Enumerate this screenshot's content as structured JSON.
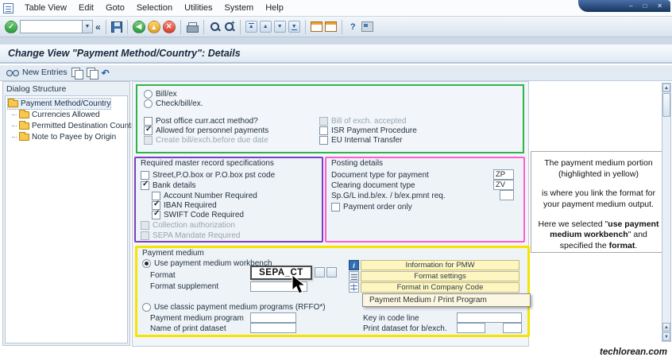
{
  "window": {
    "menu": [
      "Table View",
      "Edit",
      "Goto",
      "Selection",
      "Utilities",
      "System",
      "Help"
    ],
    "title": "Change View \"Payment Method/Country\": Details"
  },
  "icons": {
    "enter": "✓",
    "dropdown": "▼",
    "collapse": "«",
    "back": "◀",
    "exit": "▲",
    "cancel": "✕",
    "page_first": "▲",
    "page_prev": "▲",
    "page_next": "▼",
    "page_last": "▼",
    "help": "?",
    "undo": "↶",
    "minimize": "–",
    "restore": "□",
    "close": "✕",
    "info": "i",
    "scroll_up": "▲",
    "scroll_down": "▼"
  },
  "app_toolbar": {
    "new_entries": "New Entries"
  },
  "dialog_structure": {
    "title": "Dialog Structure",
    "items": [
      {
        "label": "Payment Method/Country",
        "selected": true
      },
      {
        "label": "Currencies Allowed",
        "selected": false
      },
      {
        "label": "Permitted Destination Countries",
        "selected": false
      },
      {
        "label": "Note to Payee by Origin",
        "selected": false
      }
    ]
  },
  "payment_method_section": {
    "radios": [
      {
        "label": "Bill/ex",
        "checked": false
      },
      {
        "label": "Check/bill/ex.",
        "checked": false
      }
    ],
    "left_checkboxes": [
      {
        "label": "Post office curr.acct method?",
        "checked": false,
        "disabled": false
      },
      {
        "label": "Allowed for personnel payments",
        "checked": true,
        "disabled": false
      },
      {
        "label": "Create bill/exch.before due date",
        "checked": false,
        "disabled": true
      }
    ],
    "right_checkboxes": [
      {
        "label": "Bill of exch. accepted",
        "checked": false,
        "disabled": true
      },
      {
        "label": "ISR Payment Procedure",
        "checked": false,
        "disabled": false
      },
      {
        "label": "EU Internal Transfer",
        "checked": false,
        "disabled": false
      }
    ]
  },
  "master_record_section": {
    "title": "Required master record specifications",
    "checkboxes": [
      {
        "label": "Street,P.O.box or P.O.box pst code",
        "checked": false,
        "disabled": false,
        "indent": 0
      },
      {
        "label": "Bank details",
        "checked": true,
        "disabled": false,
        "indent": 0
      },
      {
        "label": "Account Number Required",
        "checked": false,
        "disabled": false,
        "indent": 1
      },
      {
        "label": "IBAN Required",
        "checked": true,
        "disabled": false,
        "indent": 1
      },
      {
        "label": "SWIFT Code Required",
        "checked": true,
        "disabled": false,
        "indent": 1
      },
      {
        "label": "Collection authorization",
        "checked": false,
        "disabled": true,
        "indent": 0
      },
      {
        "label": "SEPA Mandate Required",
        "checked": false,
        "disabled": true,
        "indent": 0
      }
    ]
  },
  "posting_details_section": {
    "title": "Posting details",
    "fields": [
      {
        "label": "Document type for payment",
        "value": "ZP"
      },
      {
        "label": "Clearing document type",
        "value": "ZV"
      },
      {
        "label": "Sp.G/L ind.b/ex. / b/ex.pmnt req.",
        "value": ""
      }
    ],
    "checkbox": {
      "label": "Payment order only",
      "checked": false
    }
  },
  "payment_medium_section": {
    "title": "Payment medium",
    "workbench_radio": {
      "label": "Use payment medium workbench",
      "checked": true
    },
    "format": {
      "label": "Format",
      "value": "SEPA_CT"
    },
    "format_supplement": {
      "label": "Format supplement",
      "value": ""
    },
    "buttons": [
      {
        "label": "Information for PMW"
      },
      {
        "label": "Format settings"
      },
      {
        "label": "Format in Company Code"
      }
    ],
    "classic_radio": {
      "label": "Use classic payment medium programs (RFFO*)",
      "checked": false
    },
    "fields": [
      {
        "label": "Payment medium program",
        "value": ""
      },
      {
        "label": "Key in code line",
        "value": ""
      },
      {
        "label": "Name of print dataset",
        "value": ""
      },
      {
        "label": "Print dataset for b/exch.",
        "value": ""
      }
    ],
    "tooltip": "Payment Medium / Print Program"
  },
  "annotation": {
    "p1": "The payment medium portion (highlighted in yellow)",
    "p2": "is where you link the format for your payment medium output.",
    "p3_parts": [
      "Here we selected \"",
      "use payment medium workbench",
      "\" and specified the ",
      "format",
      "."
    ]
  },
  "watermark": "techlorean.com",
  "colors": {
    "highlight_green": "#2fb34d",
    "highlight_purple": "#7b3fbf",
    "highlight_pink": "#ff5fd0",
    "highlight_yellow": "#f6e400"
  }
}
